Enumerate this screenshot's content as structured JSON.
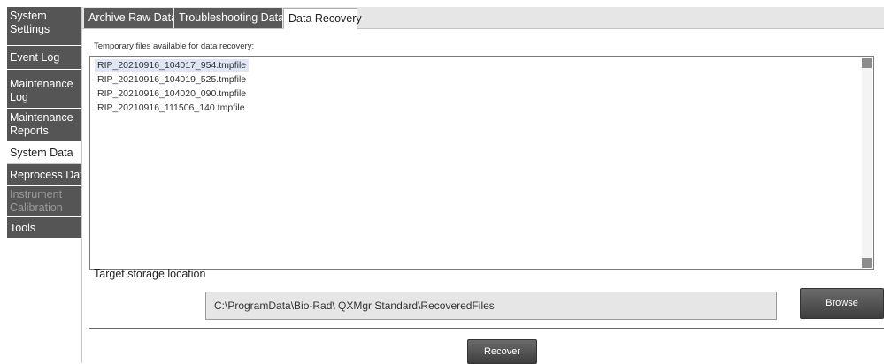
{
  "sidebar": {
    "items": [
      {
        "label": "System Settings",
        "state": "normal"
      },
      {
        "label": "Event Log",
        "state": "normal"
      },
      {
        "label": "Maintenance Log",
        "state": "normal"
      },
      {
        "label": "Maintenance Reports",
        "state": "normal"
      },
      {
        "label": "System Data",
        "state": "active"
      },
      {
        "label": "Reprocess Data",
        "state": "normal"
      },
      {
        "label": "Instrument Calibration",
        "state": "disabled"
      },
      {
        "label": "Tools",
        "state": "normal"
      }
    ]
  },
  "tabs": [
    {
      "label": "Archive Raw Data",
      "active": false
    },
    {
      "label": "Troubleshooting Data",
      "active": false
    },
    {
      "label": "Data Recovery",
      "active": true
    }
  ],
  "recovery": {
    "files_label": "Temporary files available for data recovery:",
    "files": [
      "RIP_20210916_104017_954.tmpfile",
      "RIP_20210916_104019_525.tmpfile",
      "RIP_20210916_104020_090.tmpfile",
      "RIP_20210916_111506_140.tmpfile"
    ],
    "selected_file": "RIP_20210916_104017_954.tmpfile",
    "target_label": "Target storage location",
    "target_path": "C:\\ProgramData\\Bio-Rad\\ QXMgr Standard\\RecoveredFiles",
    "browse_label": "Browse",
    "recover_label": "Recover"
  },
  "colors": {
    "sidebar_item": "#555555",
    "tab_inactive": "#595959",
    "selected_row": "#dfe7f6",
    "button": "#4a4a4a"
  }
}
